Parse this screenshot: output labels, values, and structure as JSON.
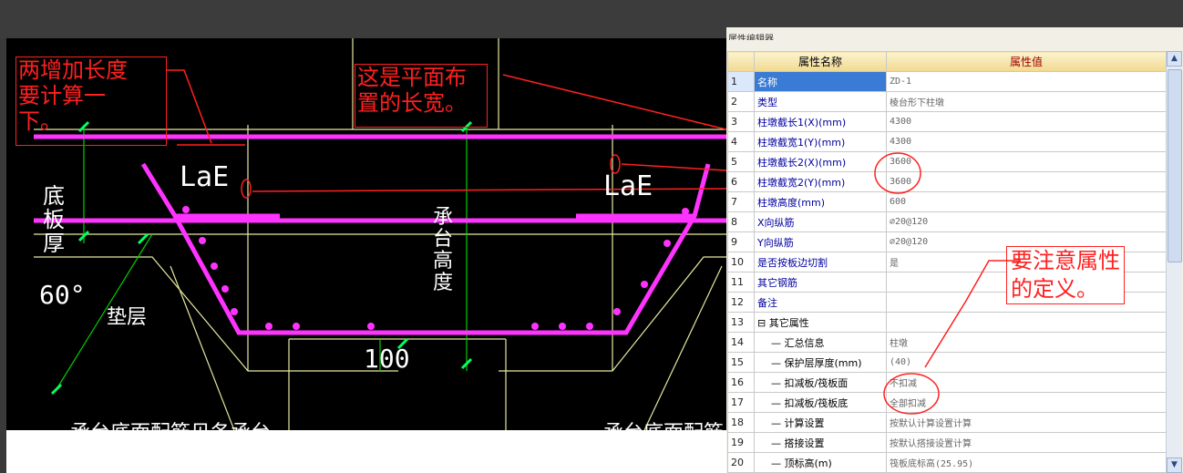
{
  "cad": {
    "note_left": "两增加长度\n要计算一\n下。",
    "note_center": "这是平面布\n置的长宽。",
    "label_lae_left": "LaE",
    "label_lae_right": "LaE",
    "label_bottom_thick": "底板厚",
    "label_cap_height": "承台高度",
    "label_angle": "60°",
    "label_cushion": "垫层",
    "label_100": "100",
    "label_bottom_left": "承台底面配筋见各承台",
    "label_bottom_right": "承台底面配筋"
  },
  "panel": {
    "title": "属性编辑器",
    "header_name": "属性名称",
    "header_value": "属性值",
    "rows": [
      {
        "num": "1",
        "name": "名称",
        "value": "ZD-1"
      },
      {
        "num": "2",
        "name": "类型",
        "value": "棱台形下柱墩"
      },
      {
        "num": "3",
        "name": "柱墩截长1(X)(mm)",
        "value": "4300"
      },
      {
        "num": "4",
        "name": "柱墩截宽1(Y)(mm)",
        "value": "4300"
      },
      {
        "num": "5",
        "name": "柱墩截长2(X)(mm)",
        "value": "3600"
      },
      {
        "num": "6",
        "name": "柱墩截宽2(Y)(mm)",
        "value": "3600"
      },
      {
        "num": "7",
        "name": "柱墩高度(mm)",
        "value": "600"
      },
      {
        "num": "8",
        "name": "X向纵筋",
        "value": "⌀20@120"
      },
      {
        "num": "9",
        "name": "Y向纵筋",
        "value": "⌀20@120"
      },
      {
        "num": "10",
        "name": "是否按板边切割",
        "value": "是"
      },
      {
        "num": "11",
        "name": "其它钢筋",
        "value": ""
      },
      {
        "num": "12",
        "name": "备注",
        "value": ""
      },
      {
        "num": "13",
        "name": "其它属性",
        "value": ""
      },
      {
        "num": "14",
        "name": "汇总信息",
        "value": "柱墩"
      },
      {
        "num": "15",
        "name": "保护层厚度(mm)",
        "value": "(40)"
      },
      {
        "num": "16",
        "name": "扣减板/筏板面",
        "value": "不扣减"
      },
      {
        "num": "17",
        "name": "扣减板/筏板底",
        "value": "全部扣减"
      },
      {
        "num": "18",
        "name": "计算设置",
        "value": "按默认计算设置计算"
      },
      {
        "num": "19",
        "name": "搭接设置",
        "value": "按默认搭接设置计算"
      },
      {
        "num": "20",
        "name": "顶标高(m)",
        "value": "筏板底标高(25.95)"
      }
    ],
    "note_right": "要注意属性\n的定义。"
  },
  "colors": {
    "magenta": "#ff33ff",
    "annot": "#ff2020",
    "cadline": "#f0f0a0",
    "green": "#00d000"
  }
}
